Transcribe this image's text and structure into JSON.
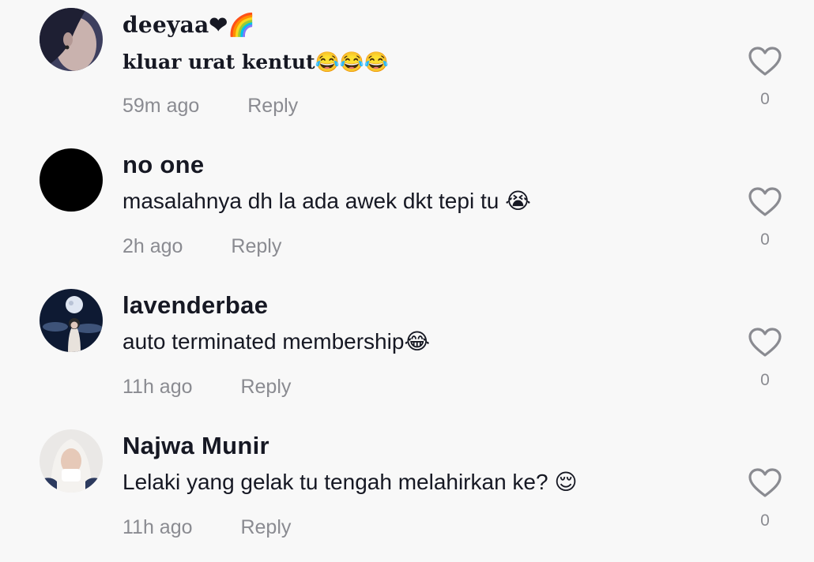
{
  "comments": [
    {
      "username": "deeyaa❤🌈",
      "text": "kluar urat kentut😂😂😂",
      "time": "59m ago",
      "reply_label": "Reply",
      "likes": "0"
    },
    {
      "username": "no one",
      "text": "masalahnya dh la ada awek dkt tepi tu 😭",
      "time": "2h ago",
      "reply_label": "Reply",
      "likes": "0"
    },
    {
      "username": "lavenderbae",
      "text": "auto terminated membership😂",
      "time": "11h ago",
      "reply_label": "Reply",
      "likes": "0"
    },
    {
      "username": "Najwa Munir",
      "text": "Lelaki yang gelak tu tengah melahirkan ke? 😌",
      "time": "11h ago",
      "reply_label": "Reply",
      "likes": "0"
    }
  ],
  "icons": {
    "like": "heart-outline-icon"
  },
  "colors": {
    "background": "#f8f8f8",
    "text_primary": "#161823",
    "text_secondary": "#8a8b91"
  }
}
